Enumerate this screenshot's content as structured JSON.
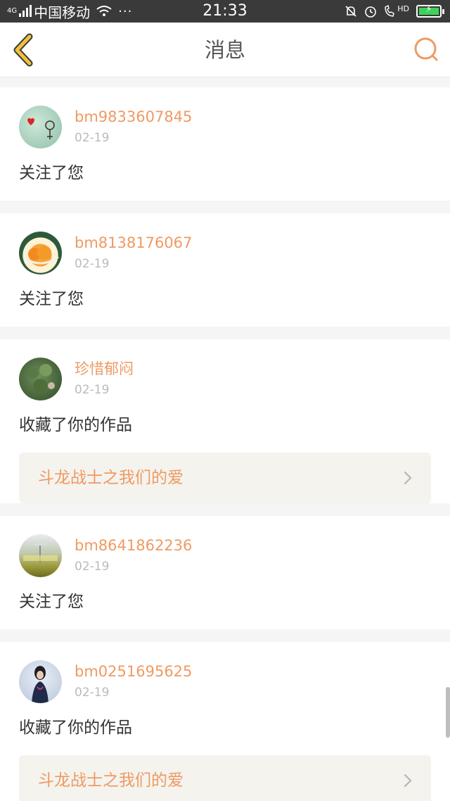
{
  "status_bar": {
    "network_label": "4G",
    "carrier": "中国移动",
    "dots": "···",
    "time": "21:33",
    "hd_label": "HD"
  },
  "header": {
    "title": "消息"
  },
  "colors": {
    "accent_orange": "#ef9a63",
    "back_yellow": "#f0c13a",
    "work_bg": "#f4f3ee"
  },
  "messages": [
    {
      "username": "bm9833607845",
      "date": "02-19",
      "action": "关注了您"
    },
    {
      "username": "bm8138176067",
      "date": "02-19",
      "action": "关注了您"
    },
    {
      "username": "珍惜郁闷",
      "date": "02-19",
      "action": "收藏了你的作品",
      "work_title": "斗龙战士之我们的爱"
    },
    {
      "username": "bm8641862236",
      "date": "02-19",
      "action": "关注了您"
    },
    {
      "username": "bm0251695625",
      "date": "02-19",
      "action": "收藏了你的作品",
      "work_title": "斗龙战士之我们的爱"
    }
  ]
}
